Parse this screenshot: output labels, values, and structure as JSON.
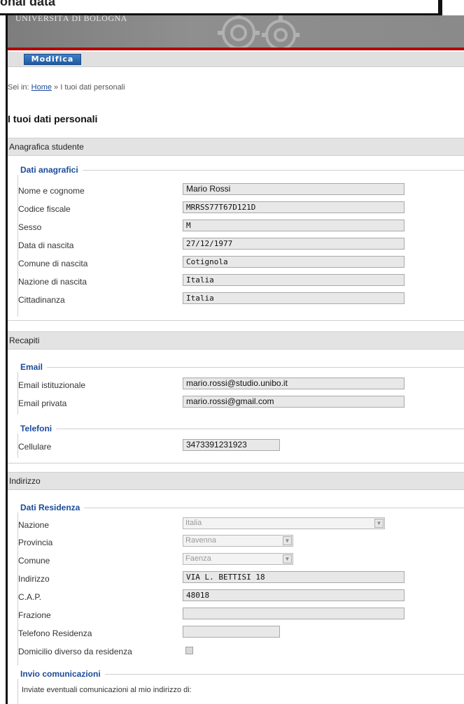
{
  "caption": "onal data",
  "header": {
    "university": "UNIVERSITÀ DI BOLOGNA"
  },
  "toolbar": {
    "modifica_label": "Modifica"
  },
  "breadcrumb": {
    "prefix": "Sei in:",
    "home": "Home",
    "separator": "»",
    "current": "I tuoi dati personali"
  },
  "page": {
    "title": "I tuoi dati personali"
  },
  "anagrafica": {
    "heading": "Anagrafica studente",
    "legend": "Dati anagrafici",
    "rows": [
      {
        "label": "Nome e cognome",
        "value": "Mario Rossi"
      },
      {
        "label": "Codice fiscale",
        "value": "MRRSS77T67D121D"
      },
      {
        "label": "Sesso",
        "value": "M"
      },
      {
        "label": "Data di nascita",
        "value": "27/12/1977"
      },
      {
        "label": "Comune di nascita",
        "value": "Cotignola"
      },
      {
        "label": "Nazione di nascita",
        "value": "Italia"
      },
      {
        "label": "Cittadinanza",
        "value": "Italia"
      }
    ]
  },
  "recapiti": {
    "heading": "Recapiti",
    "email_legend": "Email",
    "email_rows": [
      {
        "label": "Email istituzionale",
        "value": "mario.rossi@studio.unibo.it"
      },
      {
        "label": "Email privata",
        "value": "mario.rossi@gmail.com"
      }
    ],
    "phone_legend": "Telefoni",
    "phone_rows": [
      {
        "label": "Cellulare",
        "value": "3473391231923"
      }
    ]
  },
  "indirizzo": {
    "heading": "Indirizzo",
    "legend": "Dati Residenza",
    "nazione": {
      "label": "Nazione",
      "value": "Italia"
    },
    "provincia": {
      "label": "Provincia",
      "value": "Ravenna"
    },
    "comune": {
      "label": "Comune",
      "value": "Faenza"
    },
    "indirizzo": {
      "label": "Indirizzo",
      "value": "VIA L. BETTISI 18"
    },
    "cap": {
      "label": "C.A.P.",
      "value": "48018"
    },
    "frazione": {
      "label": "Frazione",
      "value": ""
    },
    "telefono": {
      "label": "Telefono Residenza",
      "value": ""
    },
    "domicilio": {
      "label": "Domicilio diverso da residenza",
      "checked": false
    }
  },
  "invio": {
    "legend": "Invio comunicazioni",
    "note": "Inviate eventuali comunicazioni al mio indirizzo di:"
  }
}
